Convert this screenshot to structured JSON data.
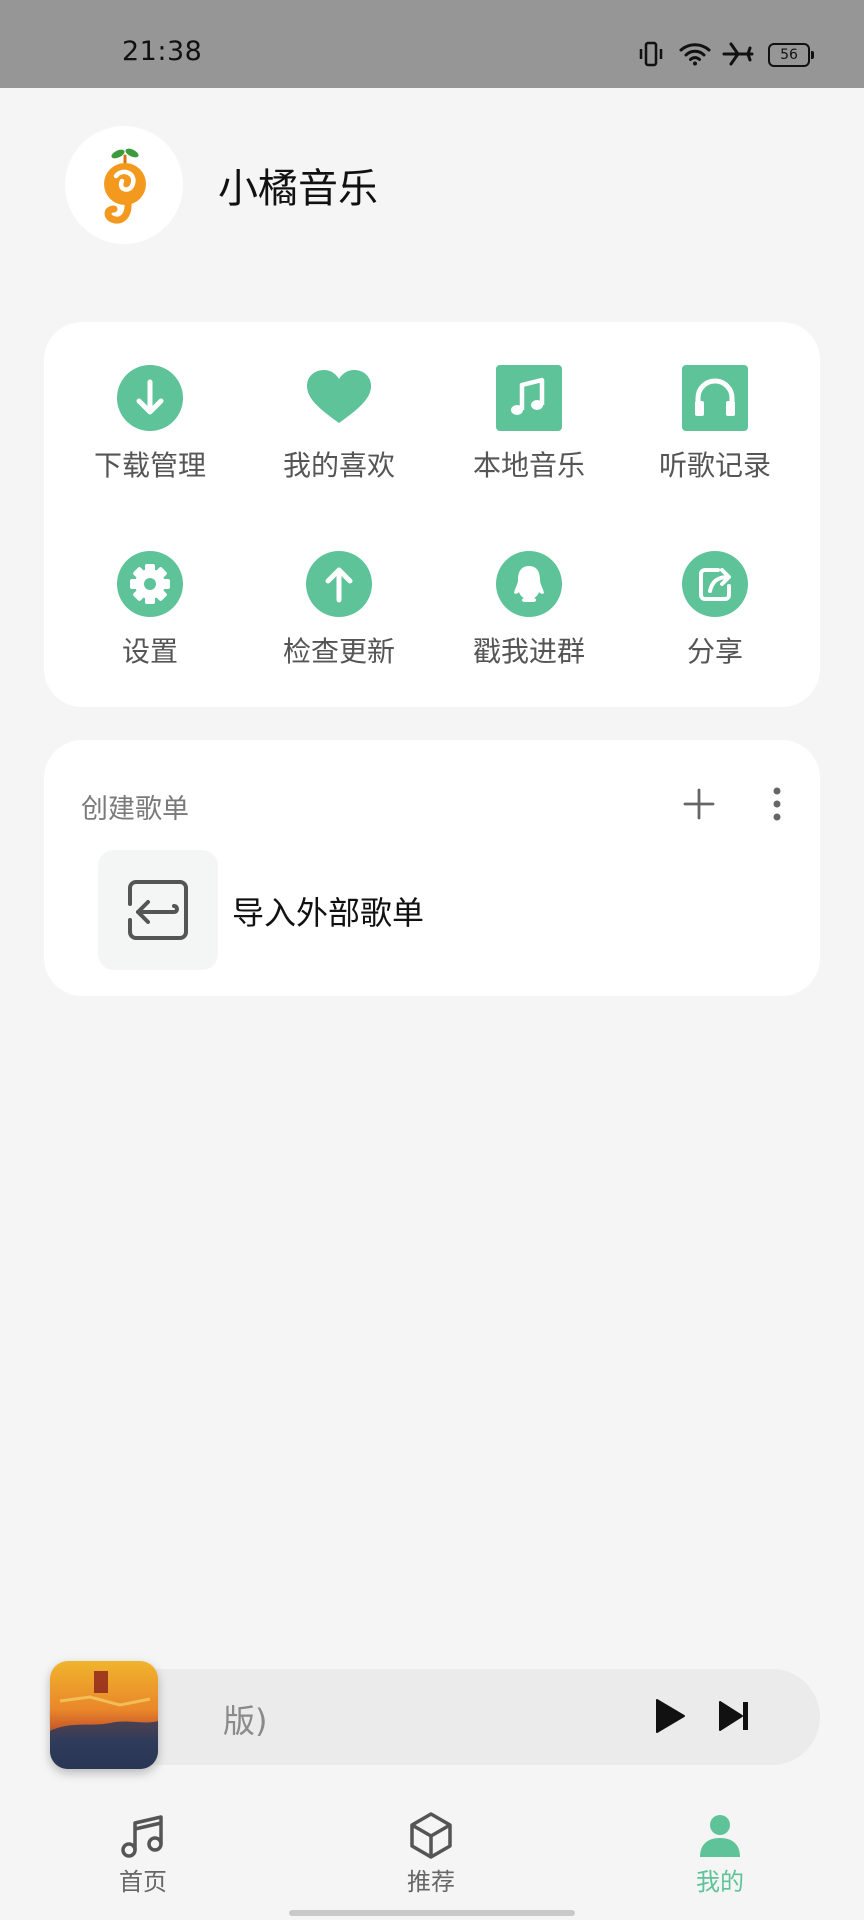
{
  "status_bar": {
    "time": "21:38",
    "battery": "56",
    "icons": [
      "vibrate-icon",
      "wifi-icon",
      "airplane-mode-icon",
      "battery-icon"
    ]
  },
  "header": {
    "app_title": "小橘音乐",
    "logo_icon": "orange-music-note-logo"
  },
  "quick_actions": [
    {
      "label": "下载管理",
      "icon": "download-icon"
    },
    {
      "label": "我的喜欢",
      "icon": "heart-icon"
    },
    {
      "label": "本地音乐",
      "icon": "music-note-icon"
    },
    {
      "label": "听歌记录",
      "icon": "headphones-icon"
    },
    {
      "label": "设置",
      "icon": "gear-icon"
    },
    {
      "label": "检查更新",
      "icon": "upload-icon"
    },
    {
      "label": "戳我进群",
      "icon": "qq-icon"
    },
    {
      "label": "分享",
      "icon": "share-icon"
    }
  ],
  "playlists": {
    "section_title": "创建歌单",
    "add_icon": "plus-icon",
    "more_icon": "more-vertical-icon",
    "import_label": "导入外部歌单",
    "import_icon": "import-icon"
  },
  "mini_player": {
    "track_text": "版)",
    "play_icon": "play-icon",
    "next_icon": "skip-next-icon"
  },
  "bottom_nav": [
    {
      "label": "首页",
      "icon": "music-notes-icon",
      "active": false
    },
    {
      "label": "推荐",
      "icon": "cube-icon",
      "active": false
    },
    {
      "label": "我的",
      "icon": "person-icon",
      "active": true
    }
  ],
  "colors": {
    "accent": "#5ec398",
    "background": "#f5f5f5",
    "status_bar": "#969696"
  }
}
